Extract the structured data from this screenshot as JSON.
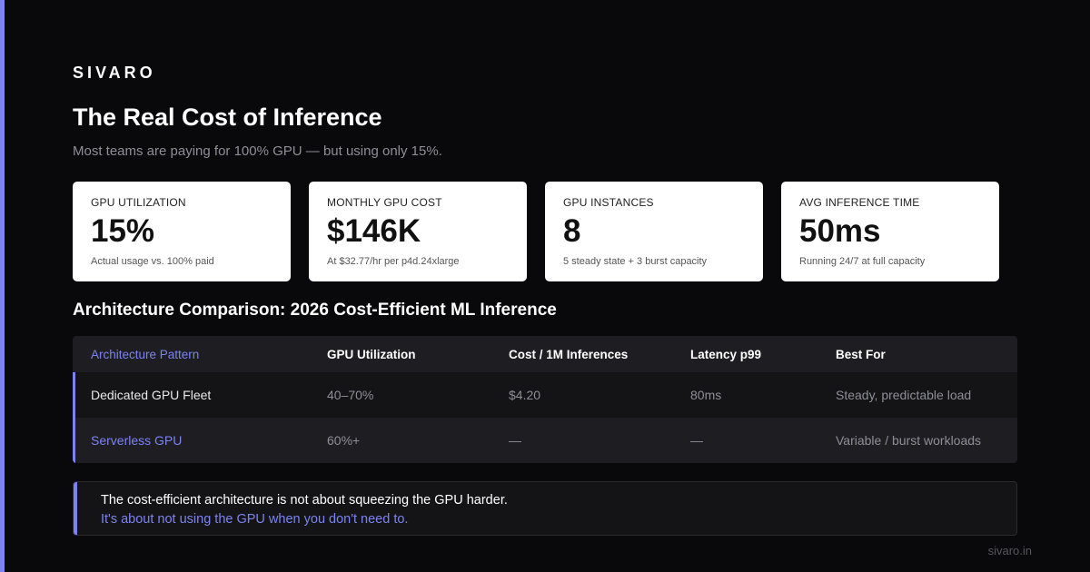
{
  "brand": "SIVARO",
  "title": "The Real Cost of Inference",
  "subtitle": "Most teams are paying for 100% GPU — but using only 15%.",
  "cards": [
    {
      "label": "GPU Utilization",
      "value": "15%",
      "note": "Actual usage vs. 100% paid"
    },
    {
      "label": "Monthly GPU Cost",
      "value": "$146K",
      "note": "At $32.77/hr per p4d.24xlarge"
    },
    {
      "label": "GPU Instances",
      "value": "8",
      "note": "5 steady state + 3 burst capacity"
    },
    {
      "label": "Avg Inference Time",
      "value": "50ms",
      "note": "Running 24/7 at full capacity"
    }
  ],
  "section_title": "Architecture Comparison: 2026 Cost-Efficient ML Inference",
  "table": {
    "headers": [
      "Architecture Pattern",
      "GPU Utilization",
      "Cost / 1M Inferences",
      "Latency p99",
      "Best For"
    ],
    "rows": [
      [
        "Dedicated GPU Fleet",
        "40–70%",
        "$4.20",
        "80ms",
        "Steady, predictable load"
      ],
      [
        "Serverless GPU",
        "60%+",
        "—",
        "—",
        "Variable / burst workloads"
      ]
    ]
  },
  "callout": {
    "line1": "The cost-efficient architecture is not about squeezing the GPU harder.",
    "line2": "It's about not using the GPU when you don't need to."
  },
  "footer": "sivaro.in",
  "colors": {
    "background": "#09090b",
    "accent": "#7c83f0",
    "card": "#ffffff",
    "muted": "#8e8e96"
  }
}
